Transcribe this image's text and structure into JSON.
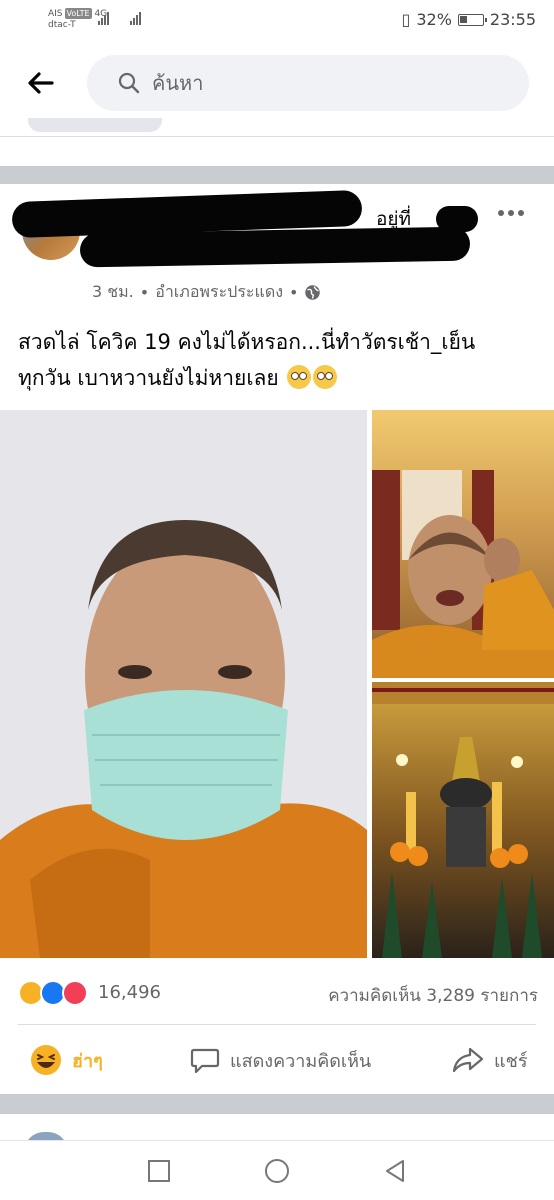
{
  "status_bar": {
    "carrier1": "AIS",
    "volte": "VoLTE",
    "network": "4G",
    "carrier2": "dtac-T",
    "battery": "32%",
    "time": "23:55"
  },
  "search": {
    "placeholder": "ค้นหา"
  },
  "post": {
    "author_suffix": "อยู่ที่",
    "time": "3 ชม.",
    "location": "อำเภอพระประแดง",
    "separator": "•",
    "caption_line1": "สวดไล่ โควิค 19 คงไม่ได้หรอก...นี่ทำวัตรเช้า_เย็น",
    "caption_line2": "ทุกวัน เบาหวานยังไม่หายเลย",
    "reaction_count": "16,496",
    "comment_count": "ความคิดเห็น 3,289 รายการ",
    "actions": {
      "haha": "ฮ่าๆ",
      "comment": "แสดงความคิดเห็น",
      "share": "แชร์"
    }
  },
  "colors": {
    "haha": "#f7b125",
    "like": "#1877f2",
    "love": "#f33e58",
    "muted": "#65676b",
    "separator_band": "#c9ccd1"
  },
  "icons": [
    "back-arrow-icon",
    "search-icon",
    "more-icon",
    "globe-icon",
    "haha-icon",
    "like-icon",
    "love-icon",
    "comment-icon",
    "share-icon",
    "recent-apps-icon",
    "home-icon",
    "back-nav-icon"
  ]
}
